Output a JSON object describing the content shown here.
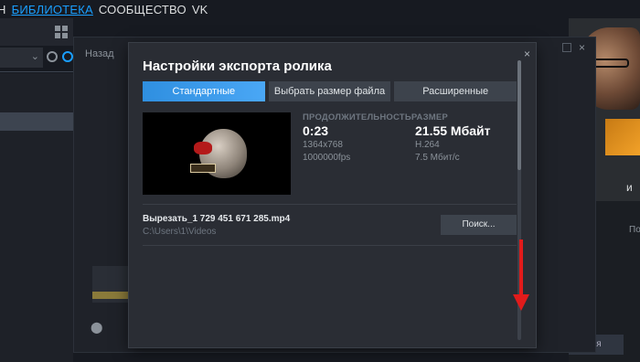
{
  "topnav": {
    "items": [
      "Н",
      "БИБЛИОТЕКА",
      "СООБЩЕСТВО",
      "VK"
    ],
    "active_index": 1
  },
  "background": {
    "back_label": "Назад",
    "right_text_1": "и",
    "right_text_2": "По",
    "right_button": "литься"
  },
  "dialog": {
    "title": "Настройки экспорта ролика",
    "close_glyph": "×",
    "tabs": [
      {
        "label": "Стандартные",
        "active": true
      },
      {
        "label": "Выбрать размер файла",
        "active": false
      },
      {
        "label": "Расширенные",
        "active": false
      }
    ],
    "meta": {
      "duration_header": "ПРОДОЛЖИТЕЛЬНОСТЬ",
      "size_header": "РАЗМЕР",
      "duration": "0:23",
      "size": "21.55 Мбайт",
      "resolution": "1364x768",
      "codec": "H.264",
      "fps": "1000000fps",
      "bitrate": "7.5 Мбит/с"
    },
    "file": {
      "name": "Вырезать_1 729 451 671 285.mp4",
      "path": "C:\\Users\\1\\Videos",
      "browse_label": "Поиск..."
    }
  },
  "colors": {
    "accent": "#1a9fff",
    "annotation": "#e11b1b"
  }
}
